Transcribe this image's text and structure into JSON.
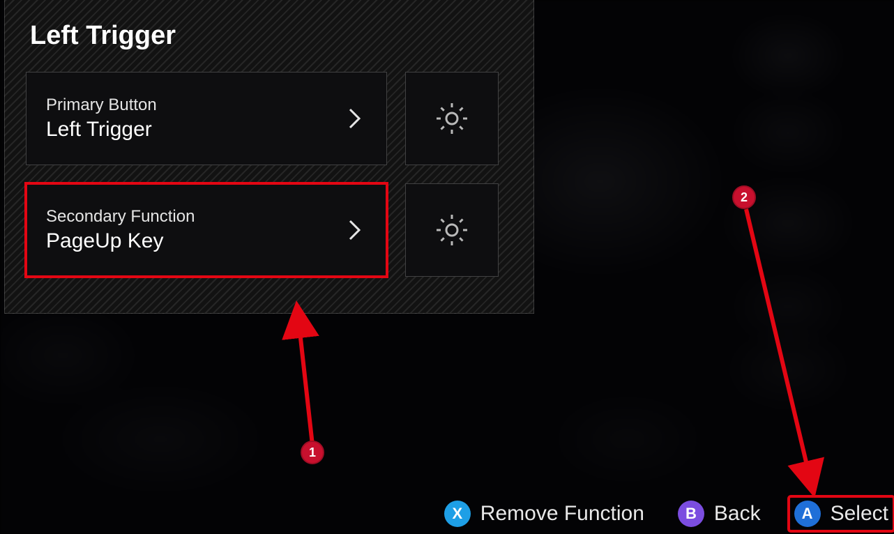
{
  "panel": {
    "title": "Left Trigger",
    "primary": {
      "label": "Primary Button",
      "value": "Left Trigger"
    },
    "secondary": {
      "label": "Secondary Function",
      "value": "PageUp Key"
    }
  },
  "actions": {
    "remove": {
      "glyph": "X",
      "label": "Remove Function"
    },
    "back": {
      "glyph": "B",
      "label": "Back"
    },
    "select": {
      "glyph": "A",
      "label": "Select"
    }
  },
  "annotations": {
    "one": "1",
    "two": "2"
  },
  "colors": {
    "highlight": "#e30613",
    "callout": "#c8102e"
  }
}
